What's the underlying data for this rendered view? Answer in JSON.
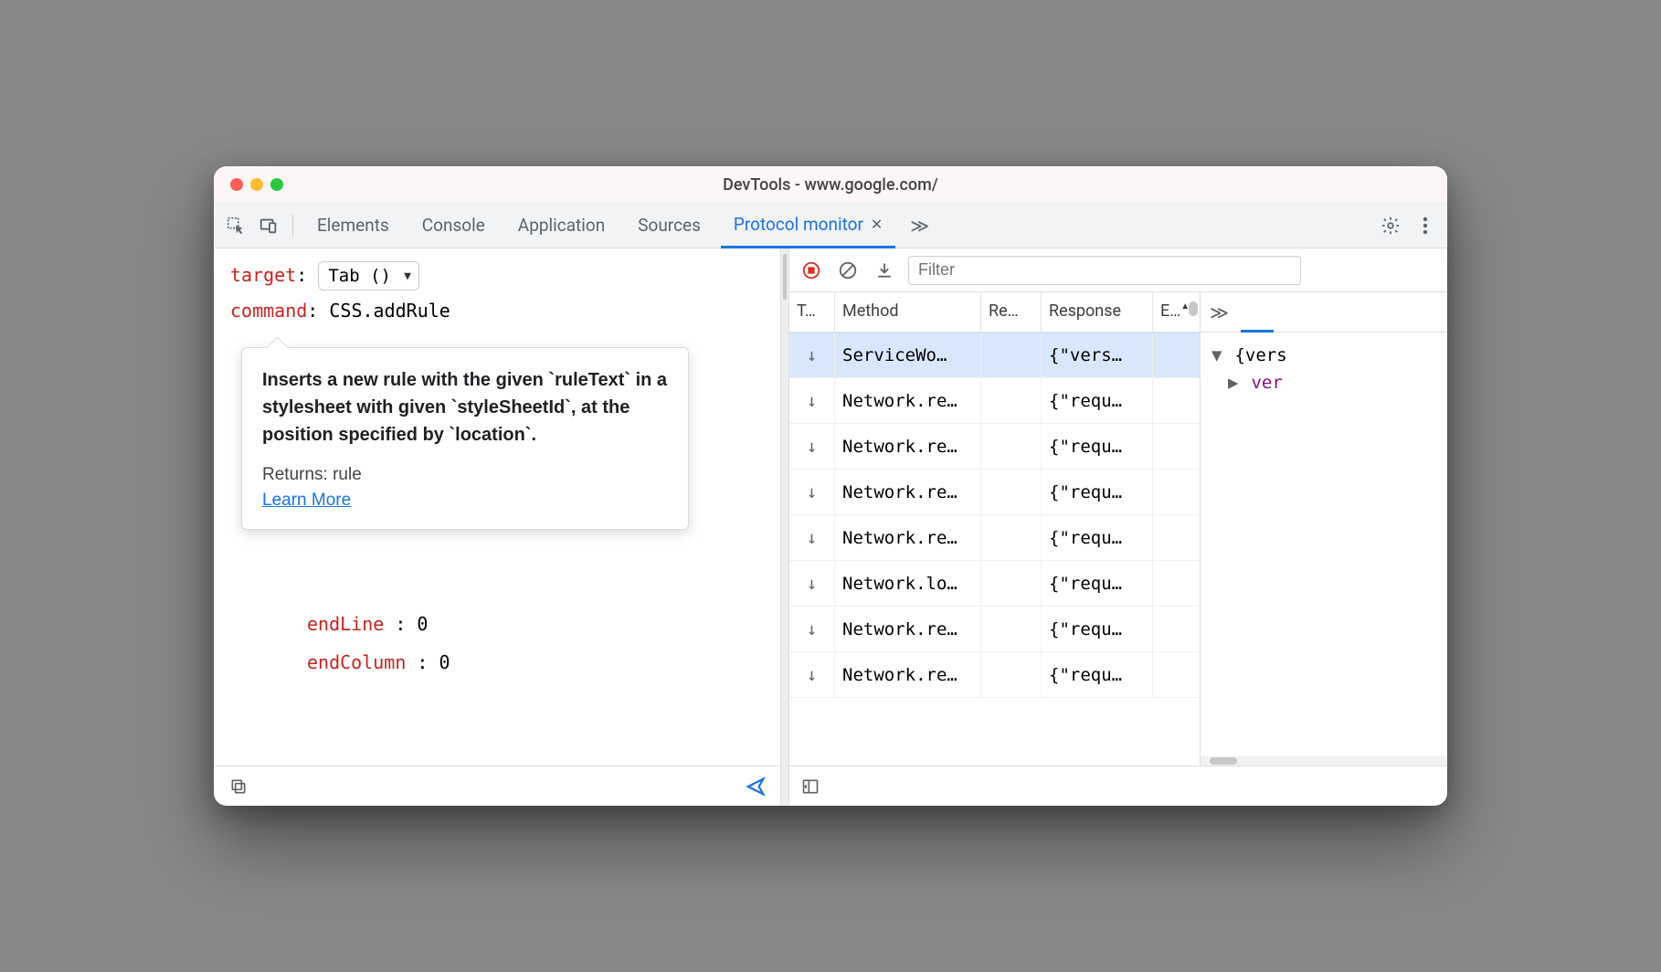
{
  "window": {
    "title": "DevTools - www.google.com/"
  },
  "tabs": {
    "items": [
      "Elements",
      "Console",
      "Application",
      "Sources",
      "Protocol monitor"
    ],
    "activeIndex": 4
  },
  "leftPane": {
    "targetLabel": "target",
    "targetValue": "Tab ()",
    "commandLabel": "command",
    "commandValue": "CSS.addRule",
    "params": {
      "endLineKey": "endLine",
      "endLineVal": "0",
      "endColumnKey": "endColumn",
      "endColumnVal": "0"
    }
  },
  "tooltip": {
    "description": "Inserts a new rule with the given `ruleText` in a stylesheet with given `styleSheetId`, at the position specified by `location`.",
    "returnsLabel": "Returns: rule",
    "learnMore": "Learn More"
  },
  "rightToolbar": {
    "filterPlaceholder": "Filter"
  },
  "table": {
    "headers": {
      "c0": "T…",
      "c1": "Method",
      "c2": "Re…",
      "c3": "Response",
      "c4": "E…"
    },
    "rows": [
      {
        "dir": "↓",
        "method": "ServiceWo…",
        "req": "",
        "resp": "{\"vers…",
        "e": "",
        "selected": true
      },
      {
        "dir": "↓",
        "method": "Network.re…",
        "req": "",
        "resp": "{\"requ…",
        "e": ""
      },
      {
        "dir": "↓",
        "method": "Network.re…",
        "req": "",
        "resp": "{\"requ…",
        "e": ""
      },
      {
        "dir": "↓",
        "method": "Network.re…",
        "req": "",
        "resp": "{\"requ…",
        "e": ""
      },
      {
        "dir": "↓",
        "method": "Network.re…",
        "req": "",
        "resp": "{\"requ…",
        "e": ""
      },
      {
        "dir": "↓",
        "method": "Network.lo…",
        "req": "",
        "resp": "{\"requ…",
        "e": ""
      },
      {
        "dir": "↓",
        "method": "Network.re…",
        "req": "",
        "resp": "{\"requ…",
        "e": ""
      },
      {
        "dir": "↓",
        "method": "Network.re…",
        "req": "",
        "resp": "{\"requ…",
        "e": ""
      }
    ]
  },
  "preview": {
    "root": "{vers",
    "child": "ver"
  },
  "icons": {
    "chevrons": "≫",
    "sortUp": "▲"
  }
}
